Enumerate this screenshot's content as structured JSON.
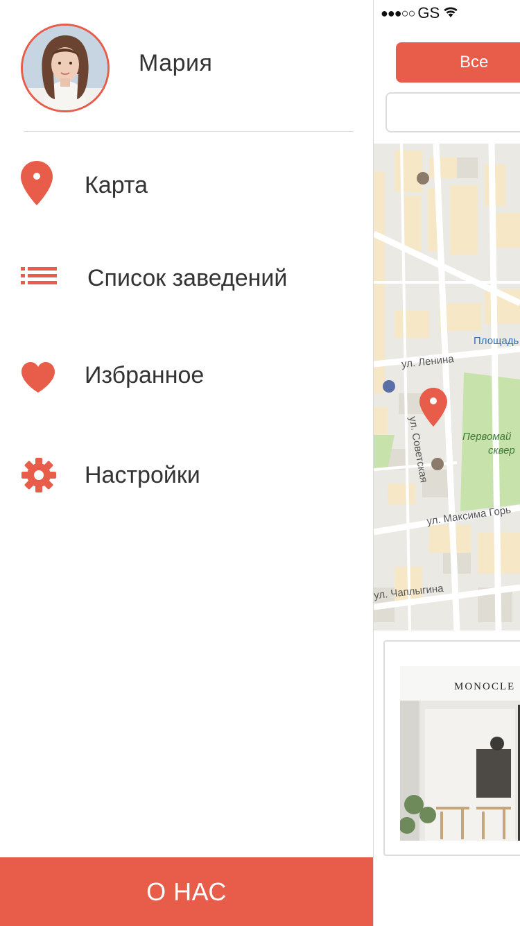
{
  "drawer": {
    "user_name": "Мария",
    "menu": [
      {
        "label": "Карта",
        "icon": "map-pin-icon"
      },
      {
        "label": "Список заведений",
        "icon": "list-icon"
      },
      {
        "label": "Избранное",
        "icon": "heart-icon"
      },
      {
        "label": "Настройки",
        "icon": "gear-icon"
      }
    ],
    "about_label": "О НАС"
  },
  "status_bar": {
    "dots": "●●●○○",
    "carrier": "GS",
    "icon": "wifi-icon"
  },
  "main": {
    "filter_label": "Все",
    "search": {
      "value": "",
      "placeholder": ""
    },
    "map_labels": {
      "square": "Площадь",
      "lenina": "ул. Ленина",
      "sovetskaya": "ул. Советская",
      "park_line1": "Первомай",
      "park_line2": "сквер",
      "gorkogo": "ул. Максима Горь",
      "chaplygina": "ул. Чаплыгина"
    },
    "card": {
      "sign": "MONOCLE"
    }
  },
  "colors": {
    "accent": "#e85c4a",
    "text": "#333333",
    "divider": "#dcdcdc",
    "map_bg": "#ebe9e3",
    "map_block": "#f7e9c8",
    "park": "#c7e3ab"
  }
}
